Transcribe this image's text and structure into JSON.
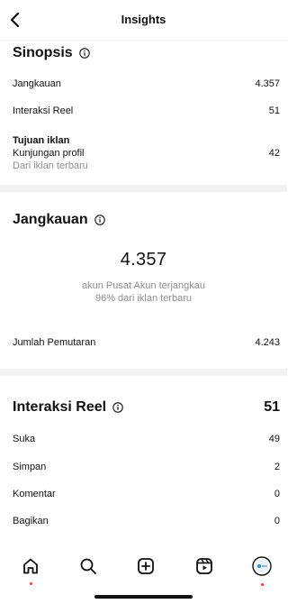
{
  "header": {
    "title": "Insights"
  },
  "sinopsis": {
    "title": "Sinopsis",
    "rows": [
      {
        "label": "Jangkauan",
        "value": "4.357"
      },
      {
        "label": "Interaksi Reel",
        "value": "51"
      }
    ],
    "ad_goal": {
      "heading": "Tujuan iklan",
      "label": "Kunjungan profil",
      "sublabel": "Dari iklan terbaru",
      "value": "42"
    }
  },
  "jangkauan": {
    "title": "Jangkauan",
    "big_number": "4.357",
    "sub_line1": "akun Pusat Akun terjangkau",
    "sub_line2": "96% dari iklan terbaru",
    "rows": [
      {
        "label": "Jumlah Pemutaran",
        "value": "4.243"
      }
    ]
  },
  "interaksi": {
    "title": "Interaksi Reel",
    "total": "51",
    "rows": [
      {
        "label": "Suka",
        "value": "49"
      },
      {
        "label": "Simpan",
        "value": "2"
      },
      {
        "label": "Komentar",
        "value": "0"
      },
      {
        "label": "Bagikan",
        "value": "0"
      }
    ]
  },
  "nav": {
    "items": [
      {
        "icon": "home-icon",
        "has_dot": true
      },
      {
        "icon": "search-icon",
        "has_dot": false
      },
      {
        "icon": "create-icon",
        "has_dot": false
      },
      {
        "icon": "reels-icon",
        "has_dot": false
      },
      {
        "icon": "profile-avatar",
        "has_dot": true
      }
    ]
  },
  "colors": {
    "text": "#111111",
    "muted": "#8e8e8e",
    "divider": "#f2f2f2",
    "notification_dot": "#ff3040"
  }
}
